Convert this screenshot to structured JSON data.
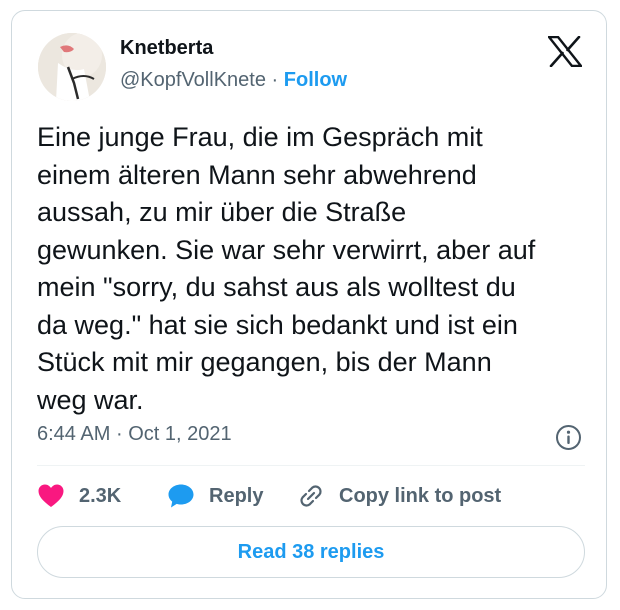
{
  "tweet": {
    "author_name": "Knetberta",
    "author_handle": "@KopfVollKnete",
    "separator": "·",
    "follow_label": "Follow",
    "text": "Eine junge Frau, die im Gespräch mit\neinem älteren Mann sehr abwehrend\naussah, zu mir über die Straße\ngewunken. Sie war sehr verwirrt, aber auf\nmein \"sorry, du sahst aus als wolltest du\nda weg.\" hat sie sich bedankt und ist ein\nStück mit mir gegangen, bis der Mann\nweg war.",
    "time": "6:44 AM",
    "date": "Oct 1, 2021",
    "likes": "2.3K",
    "reply_label": "Reply",
    "copy_label": "Copy link to post",
    "read_replies_label": "Read 38 replies"
  },
  "icons": {
    "brand": "x-logo-icon",
    "like": "heart-icon",
    "reply": "speech-bubble-icon",
    "copy": "link-icon",
    "info": "info-icon"
  },
  "colors": {
    "accent": "#1d9bf0",
    "heart": "#f91880",
    "text": "#0f1419",
    "muted": "#536471",
    "border": "#cfd9de"
  }
}
